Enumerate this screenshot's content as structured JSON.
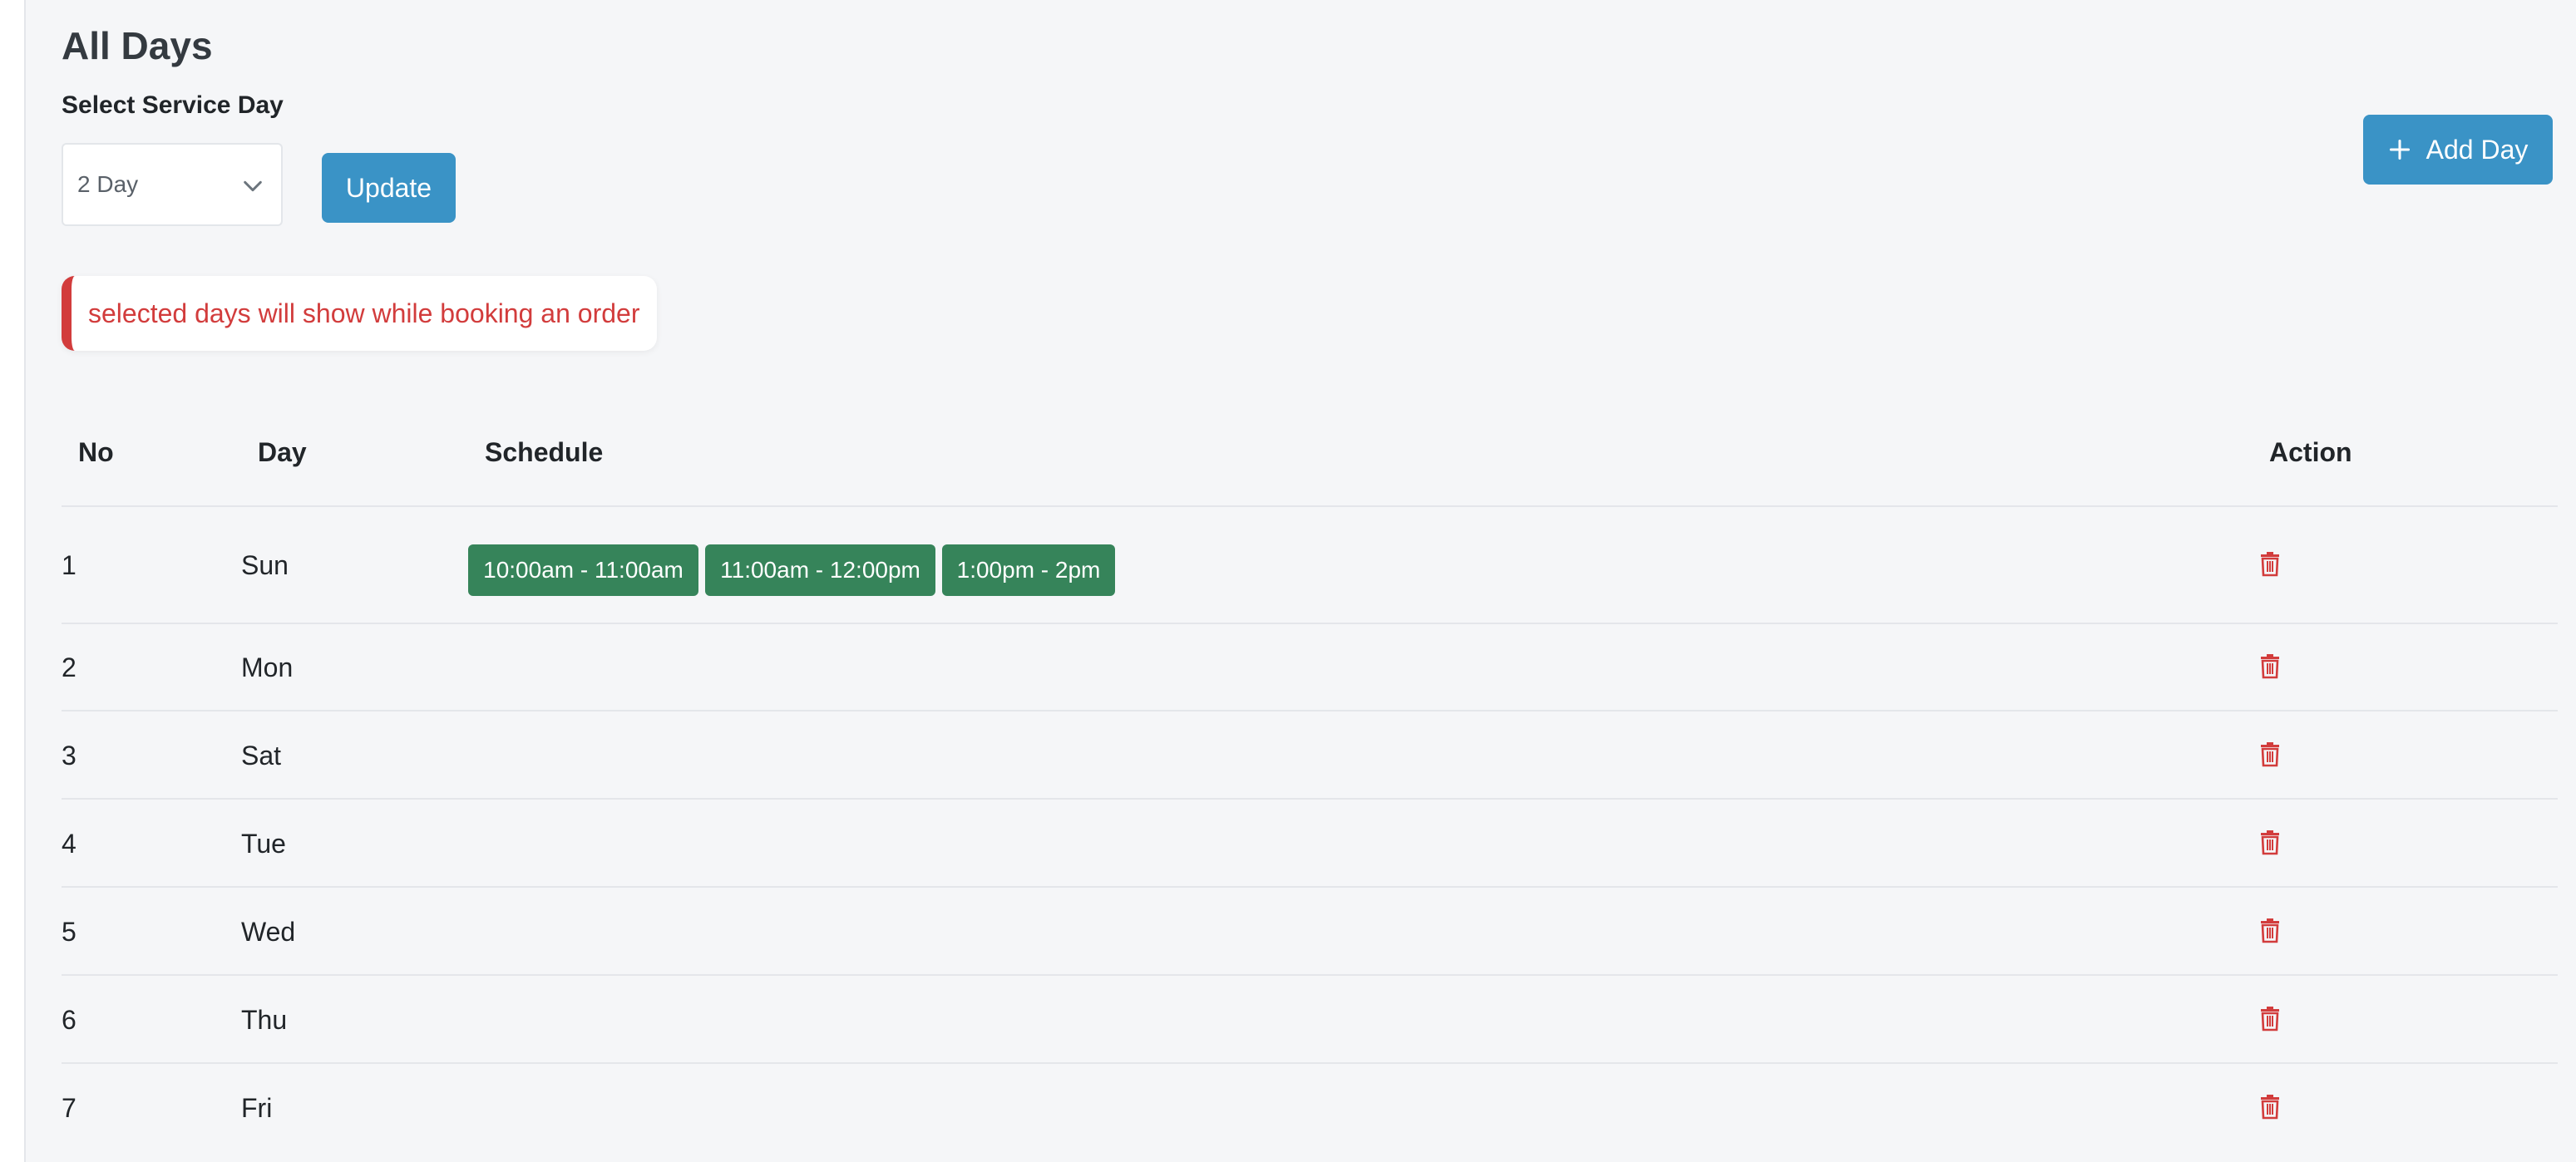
{
  "page": {
    "title": "All Days"
  },
  "service_day": {
    "label": "Select Service Day",
    "selected": "2 Day",
    "update_label": "Update"
  },
  "actions": {
    "add_day_label": "Add Day"
  },
  "alert": {
    "text": "selected days will show while booking an order"
  },
  "table": {
    "headers": [
      "No",
      "Day",
      "Schedule",
      "Action"
    ],
    "rows": [
      {
        "no": "1",
        "day": "Sun",
        "schedule": [
          "10:00am - 11:00am",
          "11:00am - 12:00pm",
          "1:00pm - 2pm"
        ]
      },
      {
        "no": "2",
        "day": "Mon",
        "schedule": []
      },
      {
        "no": "3",
        "day": "Sat",
        "schedule": []
      },
      {
        "no": "4",
        "day": "Tue",
        "schedule": []
      },
      {
        "no": "5",
        "day": "Wed",
        "schedule": []
      },
      {
        "no": "6",
        "day": "Thu",
        "schedule": []
      },
      {
        "no": "7",
        "day": "Fri",
        "schedule": []
      }
    ]
  },
  "colors": {
    "primary": "#3a93c6",
    "danger": "#d23c3c",
    "success": "#36845a"
  },
  "icons": {
    "add": "plus-icon",
    "delete": "trash-icon",
    "dropdown": "chevron-down-icon"
  }
}
